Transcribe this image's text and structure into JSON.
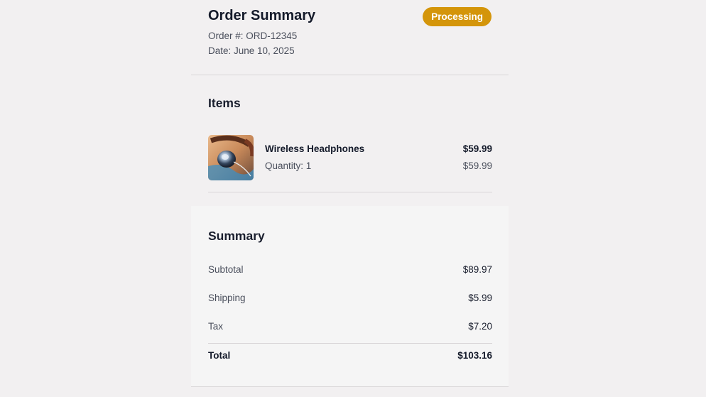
{
  "order": {
    "title": "Order Summary",
    "number": "Order #: ORD-12345",
    "date": "Date: June 10, 2025",
    "status": "Processing",
    "status_color": "#d4950a"
  },
  "items": {
    "heading": "Items",
    "list": [
      {
        "name": "Wireless Headphones",
        "quantity": "Quantity: 1",
        "price": "$59.99",
        "unit_price": "$59.99",
        "image_icon": "headphones-photo"
      }
    ]
  },
  "summary": {
    "heading": "Summary",
    "subtotal_label": "Subtotal",
    "subtotal_value": "$89.97",
    "shipping_label": "Shipping",
    "shipping_value": "$5.99",
    "tax_label": "Tax",
    "tax_value": "$7.20",
    "total_label": "Total",
    "total_value": "$103.16"
  }
}
